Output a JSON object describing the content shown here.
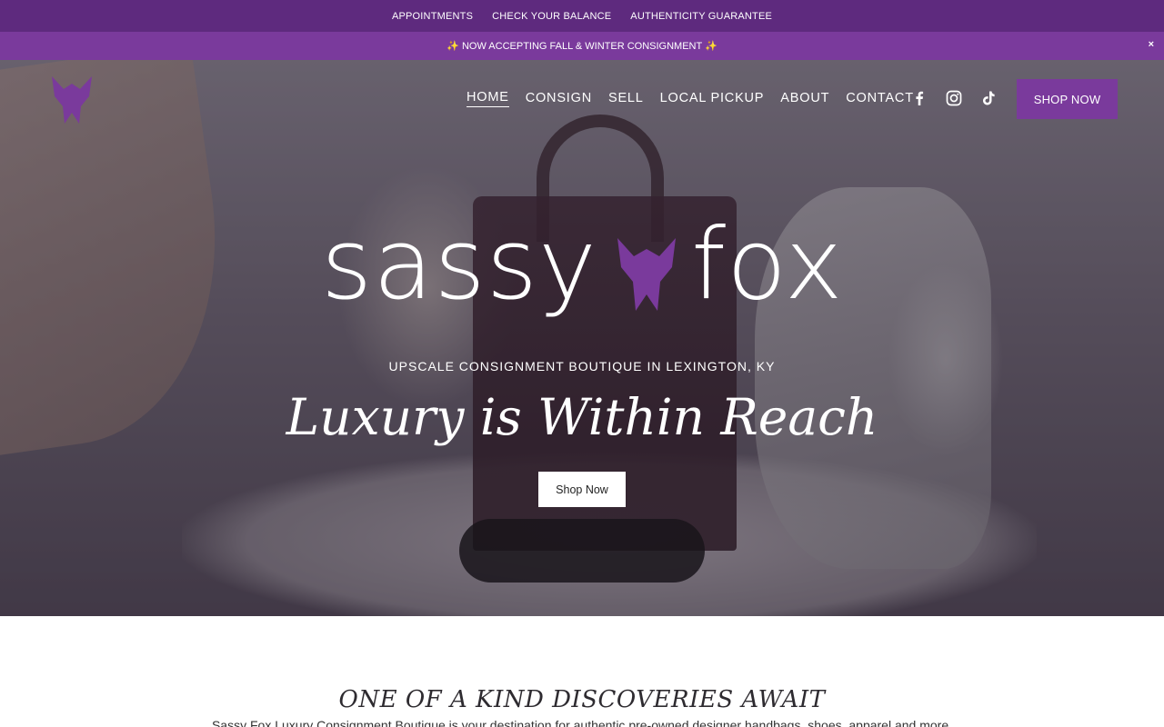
{
  "topbar": {
    "links": [
      "APPOINTMENTS",
      "CHECK YOUR BALANCE",
      "AUTHENTICITY GUARANTEE"
    ]
  },
  "announcement": {
    "text": "✨ NOW ACCEPTING FALL & WINTER CONSIGNMENT ✨",
    "close_label": "×"
  },
  "header": {
    "nav": [
      "HOME",
      "CONSIGN",
      "SELL",
      "LOCAL PICKUP",
      "ABOUT",
      "CONTACT"
    ],
    "active_nav": "HOME",
    "social_icons": [
      "facebook-icon",
      "instagram-icon",
      "tiktok-icon"
    ],
    "shop_button": "SHOP NOW"
  },
  "hero": {
    "logo_word_1": "sassy",
    "logo_word_2": "fox",
    "tagline": "UPSCALE CONSIGNMENT BOUTIQUE IN LEXINGTON, KY",
    "headline": "Luxury is Within Reach",
    "button": "Shop Now"
  },
  "intro": {
    "title": "ONE OF A KIND DISCOVERIES AWAIT",
    "text": "Sassy Fox Luxury Consignment Boutique is your destination for authentic pre-owned designer handbags, shoes, apparel and more."
  },
  "colors": {
    "brand_purple": "#7a3a9c",
    "topbar_purple": "#5e2a7e"
  }
}
